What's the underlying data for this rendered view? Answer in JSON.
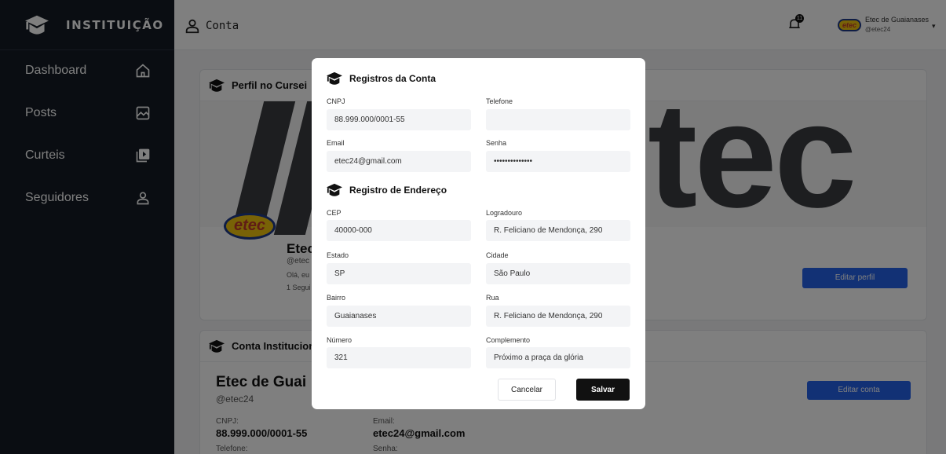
{
  "sidebar": {
    "brand": "INSTITUIÇÃO",
    "items": [
      {
        "label": "Dashboard",
        "icon": "home-icon"
      },
      {
        "label": "Posts",
        "icon": "image-icon"
      },
      {
        "label": "Curteis",
        "icon": "media-stack-icon"
      },
      {
        "label": "Seguidores",
        "icon": "user-icon"
      }
    ]
  },
  "topbar": {
    "title": "Conta",
    "notifications": "11",
    "avatar_text": "etec",
    "user_name": "Etec de Guaianases",
    "user_handle": "@etec24"
  },
  "profile_card": {
    "title": "Perfil no Cursei",
    "banner_text": "tec",
    "logo_text": "etec",
    "name": "Etec",
    "handle": "@etec",
    "bio": "Olá, eu",
    "followers": "1 Segui",
    "edit_label": "Editar perfil"
  },
  "account_card": {
    "title": "Conta Instituciona",
    "name": "Etec de Guai",
    "handle": "@etec24",
    "cnpj_label": "CNPJ:",
    "cnpj_value": "88.999.000/0001-55",
    "email_label": "Email:",
    "email_value": "etec24@gmail.com",
    "phone_label": "Telefone:",
    "password_label": "Senha:",
    "edit_label": "Editar conta"
  },
  "modal": {
    "account_section": "Registros da Conta",
    "address_section": "Registro de Endereço",
    "fields": {
      "cnpj": {
        "label": "CNPJ",
        "value": "88.999.000/0001-55"
      },
      "telefone": {
        "label": "Telefone",
        "value": ""
      },
      "email": {
        "label": "Email",
        "value": "etec24@gmail.com"
      },
      "senha": {
        "label": "Senha",
        "value": "••••••••••••••"
      },
      "cep": {
        "label": "CEP",
        "value": "40000-000"
      },
      "logradouro": {
        "label": "Logradouro",
        "value": "R. Feliciano de Mendonça, 290"
      },
      "estado": {
        "label": "Estado",
        "value": "SP"
      },
      "cidade": {
        "label": "Cidade",
        "value": "São Paulo"
      },
      "bairro": {
        "label": "Bairro",
        "value": "Guaianases"
      },
      "rua": {
        "label": "Rua",
        "value": "R. Feliciano de Mendonça, 290"
      },
      "numero": {
        "label": "Número",
        "value": "321"
      },
      "complemento": {
        "label": "Complemento",
        "value": "Próximo a praça da glória"
      }
    },
    "cancel_label": "Cancelar",
    "save_label": "Salvar"
  },
  "colors": {
    "sidebar_bg": "#141a24",
    "accent_blue": "#2563eb",
    "save_button": "#111111",
    "logo_yellow": "#f1c40f"
  }
}
